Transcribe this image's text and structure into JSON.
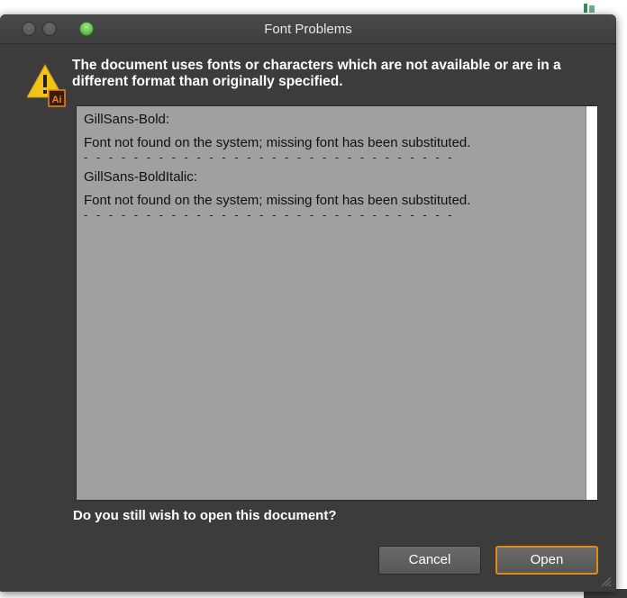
{
  "window": {
    "title": "Font Problems"
  },
  "message": "The document uses fonts or characters which are not available or are in a different format than originally specified.",
  "icons": {
    "warning": "warning-triangle-icon",
    "badge": "illustrator-badge-icon",
    "badge_text": "Ai"
  },
  "problems": [
    {
      "font": "GillSans-Bold:",
      "detail": "Font not found on the system; missing font has been substituted.",
      "separator": "- - - - - - - - - - - - - - - - - - - - - - - - - - - - - -"
    },
    {
      "font": "GillSans-BoldItalic:",
      "detail": "Font not found on the system; missing font has been substituted.",
      "separator": "- - - - - - - - - - - - - - - - - - - - - - - - - - - - - -"
    }
  ],
  "question": "Do you still wish to open this document?",
  "buttons": {
    "cancel": "Cancel",
    "open": "Open"
  },
  "colors": {
    "dialog_bg": "#3c3c3c",
    "list_bg": "#a0a0a0",
    "default_button_border": "#e3891b",
    "zoom_button": "#3aa42a"
  }
}
